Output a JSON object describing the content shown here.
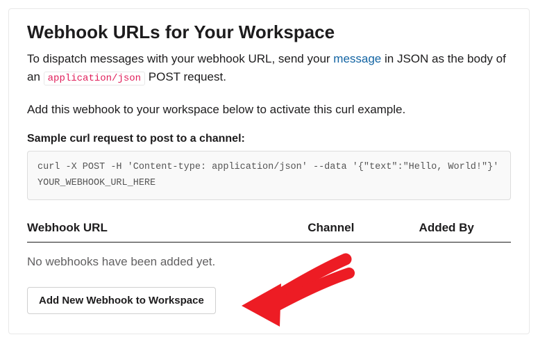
{
  "title": "Webhook URLs for Your Workspace",
  "intro_part1": "To dispatch messages with your webhook URL, send your ",
  "intro_link": "message",
  "intro_part2": " in JSON as the body of an ",
  "intro_code": "application/json",
  "intro_part3": " POST request.",
  "sub_instruction": "Add this webhook to your workspace below to activate this curl example.",
  "sample_label": "Sample curl request to post to a channel:",
  "curl_command": "curl -X POST -H 'Content-type: application/json' --data '{\"text\":\"Hello, World!\"}' YOUR_WEBHOOK_URL_HERE",
  "table": {
    "col_url": "Webhook URL",
    "col_channel": "Channel",
    "col_added_by": "Added By"
  },
  "empty_message": "No webhooks have been added yet.",
  "add_button_label": "Add New Webhook to Workspace"
}
